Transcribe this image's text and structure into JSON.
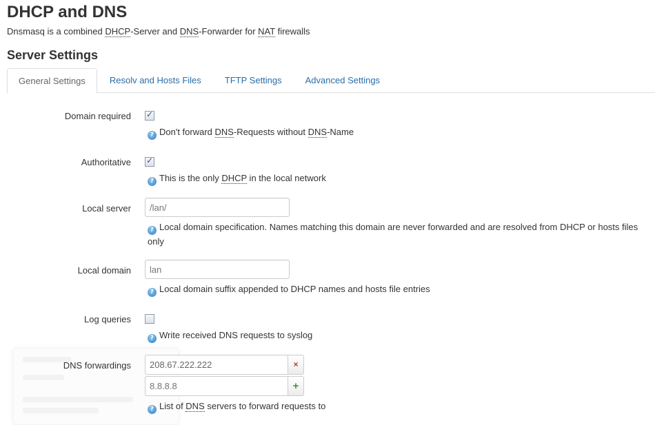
{
  "header": {
    "title": "DHCP and DNS",
    "description": {
      "p1": "Dnsmasq is a combined ",
      "abbr1": "DHCP",
      "p2": "-Server and ",
      "abbr2": "DNS",
      "p3": "-Forwarder for ",
      "abbr3": "NAT",
      "p4": " firewalls"
    }
  },
  "section": {
    "title": "Server Settings",
    "tabs": [
      {
        "label": "General Settings",
        "active": true
      },
      {
        "label": "Resolv and Hosts Files",
        "active": false
      },
      {
        "label": "TFTP Settings",
        "active": false
      },
      {
        "label": "Advanced Settings",
        "active": false
      }
    ]
  },
  "fields": {
    "domain_required": {
      "label": "Domain required",
      "checked": true,
      "help": {
        "p1": "Don't forward ",
        "abbr1": "DNS",
        "p2": "-Requests without ",
        "abbr2": "DNS",
        "p3": "-Name"
      }
    },
    "authoritative": {
      "label": "Authoritative",
      "checked": true,
      "help": {
        "p1": "This is the only ",
        "abbr1": "DHCP",
        "p2": " in the local network"
      }
    },
    "local_server": {
      "label": "Local server",
      "placeholder": "/lan/",
      "help": "Local domain specification. Names matching this domain are never forwarded and are resolved from DHCP or hosts files only"
    },
    "local_domain": {
      "label": "Local domain",
      "placeholder": "lan",
      "help": "Local domain suffix appended to DHCP names and hosts file entries"
    },
    "log_queries": {
      "label": "Log queries",
      "checked": false,
      "help": "Write received DNS requests to syslog"
    },
    "dns_forwardings": {
      "label": "DNS forwardings",
      "values": [
        "208.67.222.222"
      ],
      "new_placeholder": "8.8.8.8",
      "remove_icon": "×",
      "add_icon": "+",
      "help": {
        "p1": "List of ",
        "abbr1": "DNS",
        "p2": " servers to forward requests to"
      }
    }
  },
  "icons": {
    "help": "?"
  }
}
